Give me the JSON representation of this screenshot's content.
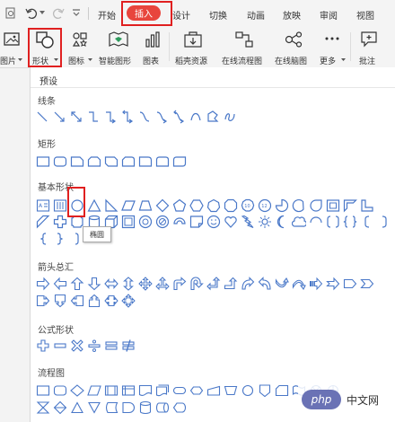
{
  "colors": {
    "accent": "#e8453c",
    "highlight": "#e02020",
    "shape_stroke": "#4a78c8"
  },
  "quick_access": [
    "print-preview-icon",
    "undo-icon",
    "redo-icon",
    "more-icon"
  ],
  "tabs": {
    "home": "开始",
    "insert": "插入",
    "design": "设计",
    "transitions": "切换",
    "animation": "动画",
    "slideshow": "放映",
    "review": "审阅",
    "view": "视图"
  },
  "ribbon": {
    "picture": "图片",
    "shapes": "形状",
    "icons": "图标",
    "smartart": "智能图形",
    "chart": "图表",
    "stock": "稻壳资源",
    "flowchart": "在线流程图",
    "mindmap": "在线脑图",
    "more": "更多",
    "comment": "批注"
  },
  "panel": {
    "title": "预设",
    "sections": {
      "lines": "线条",
      "rectangles": "矩形",
      "basic": "基本形状",
      "arrows": "箭头总汇",
      "equation": "公式形状",
      "flowchart": "流程图"
    },
    "tooltip": "椭圆"
  },
  "watermark": {
    "logo": "php",
    "text": "中文网"
  }
}
